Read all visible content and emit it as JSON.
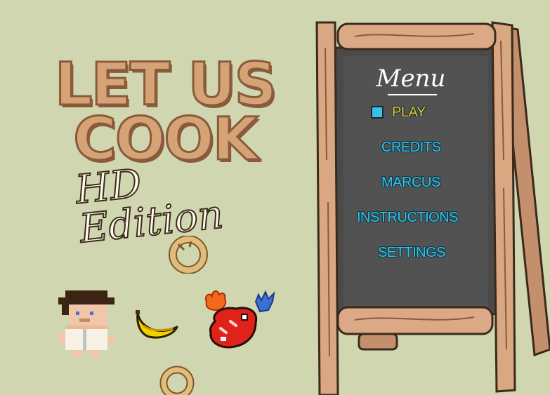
{
  "game": {
    "title_line1": "LET US",
    "title_line2": "COOK",
    "edition": "HD Edition"
  },
  "menu": {
    "heading": "Menu",
    "selected_index": 0,
    "items": [
      {
        "label": "PLAY"
      },
      {
        "label": "CREDITS"
      },
      {
        "label": "MARCUS"
      },
      {
        "label": "INSTRUCTIONS"
      },
      {
        "label": "SETTINGS"
      }
    ]
  },
  "sprites": [
    "onion-ring",
    "chef-character",
    "banana",
    "steak-with-fire-and-ice",
    "onion-ring"
  ],
  "colors": {
    "background": "#cfd6b0",
    "title_fill": "#d6a377",
    "menu_item": "#3bc1e6",
    "menu_item_selected": "#f3c021",
    "chalkboard": "#4a4a4a",
    "wood": "#d9a883"
  }
}
